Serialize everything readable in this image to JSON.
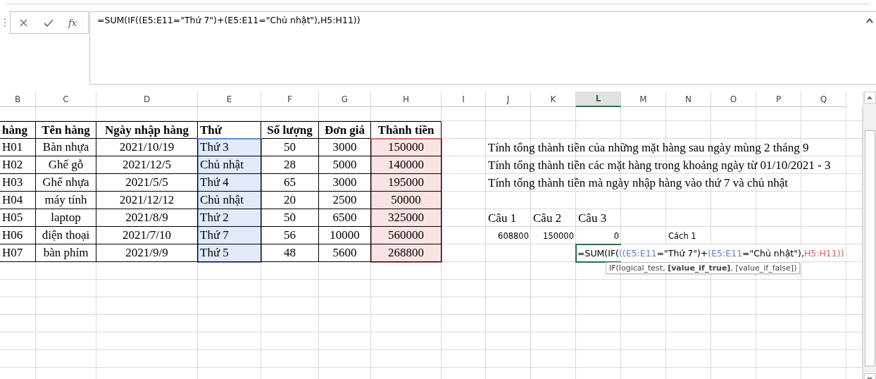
{
  "formula_bar": {
    "function_label": "fx",
    "formula": "=SUM(IF((E5:E11=\"Thứ 7\")+(E5:E11=\"Chủ nhật\"),H5:H11))"
  },
  "column_headers": [
    {
      "label": "B",
      "selected": false
    },
    {
      "label": "C",
      "selected": false
    },
    {
      "label": "D",
      "selected": false
    },
    {
      "label": "E",
      "selected": false
    },
    {
      "label": "F",
      "selected": false
    },
    {
      "label": "G",
      "selected": false
    },
    {
      "label": "H",
      "selected": false
    },
    {
      "label": "I",
      "selected": false
    },
    {
      "label": "J",
      "selected": false
    },
    {
      "label": "K",
      "selected": false
    },
    {
      "label": "L",
      "selected": true
    },
    {
      "label": "M",
      "selected": false
    },
    {
      "label": "N",
      "selected": false
    },
    {
      "label": "O",
      "selected": false
    },
    {
      "label": "P",
      "selected": false
    },
    {
      "label": "Q",
      "selected": false
    }
  ],
  "table": {
    "columns": [
      {
        "label": "hàng"
      },
      {
        "label": "Tên hàng"
      },
      {
        "label": "Ngày nhập hàng"
      },
      {
        "label": "Thứ",
        "color": "#5b8ae6"
      },
      {
        "label": "Số lượng"
      },
      {
        "label": "Đơn giá"
      },
      {
        "label": "Thành tiền",
        "color": "#e06666"
      }
    ],
    "rows": [
      [
        "H01",
        "Bàn nhựa",
        "2021/10/19",
        "Thứ 3",
        "50",
        "3000",
        "150000"
      ],
      [
        "H02",
        "Ghế gỗ",
        "2021/12/5",
        "Chủ nhật",
        "28",
        "5000",
        "140000"
      ],
      [
        "H03",
        "Ghế nhựa",
        "2021/5/5",
        "Thứ 4",
        "65",
        "3000",
        "195000"
      ],
      [
        "H04",
        "máy tính",
        "2021/12/12",
        "Chủ nhật",
        "20",
        "2500",
        "50000"
      ],
      [
        "H05",
        "laptop",
        "2021/8/9",
        "Thứ 2",
        "50",
        "6500",
        "325000"
      ],
      [
        "H06",
        "điện thoại",
        "2021/7/10",
        "Thứ 7",
        "56",
        "10000",
        "560000"
      ],
      [
        "H07",
        "bàn phím",
        "2021/9/9",
        "Thứ 5",
        "48",
        "5600",
        "268800"
      ]
    ]
  },
  "notes": [
    "Tính tổng thành tiền của những mặt hàng sau ngày mùng 2 tháng 9",
    "Tính tổng thành tiền các mặt hàng trong khoảng ngày từ 01/10/2021 - 3",
    "Tính tổng thành tiền mà ngày nhập hàng vào thứ 7 và chủ nhật"
  ],
  "answers": {
    "labels": [
      "Câu 1",
      "Câu 2",
      "Câu 3"
    ],
    "values": [
      "608800",
      "150000",
      "0"
    ],
    "method": "Cách 1"
  },
  "active_cell": {
    "segments": [
      {
        "text": "=SUM(IF(",
        "color": "#000000"
      },
      {
        "text": "((E5:E11",
        "color": "#5b7fe0"
      },
      {
        "text": "=\"Thứ 7\")+",
        "color": "#000000"
      },
      {
        "text": "(E5:E11",
        "color": "#5b7fe0"
      },
      {
        "text": "=\"Chủ nhật\"),",
        "color": "#000000"
      },
      {
        "text": "H5:H11))",
        "color": "#e06060"
      }
    ]
  },
  "tooltip": "IF(logical_test, **[value_if_true]**, [value_if_false])"
}
